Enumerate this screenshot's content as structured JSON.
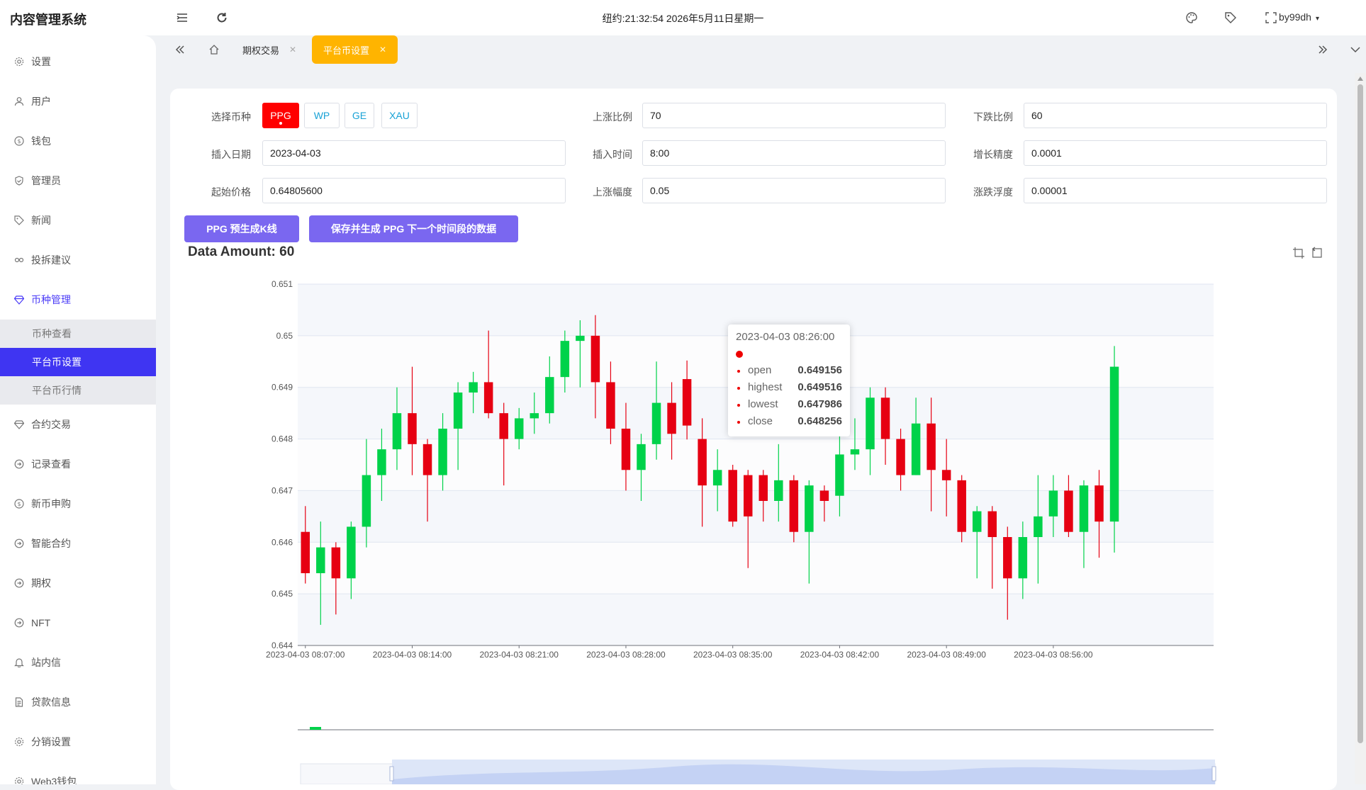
{
  "app": {
    "title": "内容管理系统",
    "clock": "纽约:21:32:54 2026年5月11日星期一",
    "user": "by99dh"
  },
  "sidebar": {
    "items": [
      {
        "label": "设置",
        "icon": "gear-icon"
      },
      {
        "label": "用户",
        "icon": "user-icon"
      },
      {
        "label": "钱包",
        "icon": "dollar-icon"
      },
      {
        "label": "管理员",
        "icon": "shield-icon"
      },
      {
        "label": "新闻",
        "icon": "tag-icon"
      },
      {
        "label": "投拆建议",
        "icon": "link-icon"
      },
      {
        "label": "币种管理",
        "icon": "diamond-icon"
      }
    ],
    "submenu": [
      {
        "label": "币种查看"
      },
      {
        "label": "平台币设置"
      },
      {
        "label": "平台币行情"
      }
    ],
    "items_after": [
      {
        "label": "合约交易",
        "icon": "diamond-icon"
      },
      {
        "label": "记录查看",
        "icon": "circle-arrow-icon"
      },
      {
        "label": "新币申购",
        "icon": "dollar-icon"
      },
      {
        "label": "智能合约",
        "icon": "circle-arrow-icon"
      },
      {
        "label": "期权",
        "icon": "circle-arrow-icon"
      },
      {
        "label": "NFT",
        "icon": "circle-arrow-icon"
      },
      {
        "label": "站内信",
        "icon": "bell-icon"
      },
      {
        "label": "贷款信息",
        "icon": "document-icon"
      },
      {
        "label": "分销设置",
        "icon": "gear-icon"
      },
      {
        "label": "Web3钱包",
        "icon": "gear-icon"
      }
    ]
  },
  "tabs": [
    {
      "label": "期权交易"
    },
    {
      "label": "平台币设置"
    }
  ],
  "form": {
    "coin_label": "选择币种",
    "coins": [
      "PPG",
      "WP",
      "GE",
      "XAU"
    ],
    "selected_coin": "PPG",
    "up_ratio_label": "上涨比例",
    "up_ratio": "70",
    "down_ratio_label": "下跌比例",
    "down_ratio": "60",
    "insert_date_label": "插入日期",
    "insert_date": "2023-04-03",
    "insert_time_label": "插入时间",
    "insert_time": "8:00",
    "precision_label": "增长精度",
    "precision": "0.0001",
    "start_price_label": "起始价格",
    "start_price": "0.64805600",
    "up_range_label": "上涨幅度",
    "up_range": "0.05",
    "float_label": "涨跌浮度",
    "float": "0.00001"
  },
  "buttons": {
    "generate": "PPG 预生成K线",
    "save": "保存并生成 PPG 下一个时间段的数据"
  },
  "data_amount": "Data Amount: 60",
  "tooltip": {
    "title": "2023-04-03 08:26:00",
    "rows": [
      {
        "key": "open",
        "value": "0.649156"
      },
      {
        "key": "highest",
        "value": "0.649516"
      },
      {
        "key": "lowest",
        "value": "0.647986"
      },
      {
        "key": "close",
        "value": "0.648256"
      }
    ]
  },
  "colors": {
    "up": "#00d24a",
    "down": "#e60012",
    "accent": "#3f35f2",
    "tab_active": "#ffb400",
    "button": "#7a67f0"
  },
  "chart_data": {
    "type": "candlestick",
    "ylim": [
      0.644,
      0.651
    ],
    "yticks": [
      0.644,
      0.645,
      0.646,
      0.647,
      0.648,
      0.649,
      0.65,
      0.651
    ],
    "ytick_labels": [
      "0.644",
      "0.645",
      "0.646",
      "0.647",
      "0.648",
      "0.649",
      "0.65",
      "0.651"
    ],
    "xtick_labels": [
      "2023-04-03 08:07:00",
      "2023-04-03 08:14:00",
      "2023-04-03 08:21:00",
      "2023-04-03 08:28:00",
      "2023-04-03 08:35:00",
      "2023-04-03 08:42:00",
      "2023-04-03 08:49:00",
      "2023-04-03 08:56:00"
    ],
    "x_start": "2023-04-03 08:07:00",
    "interval_minutes": 1,
    "candles": [
      {
        "o": 0.6462,
        "c": 0.6454,
        "h": 0.6467,
        "l": 0.6452
      },
      {
        "o": 0.6454,
        "c": 0.6459,
        "h": 0.6464,
        "l": 0.6444
      },
      {
        "o": 0.6459,
        "c": 0.6453,
        "h": 0.646,
        "l": 0.6446
      },
      {
        "o": 0.6453,
        "c": 0.6463,
        "h": 0.6464,
        "l": 0.6449
      },
      {
        "o": 0.6463,
        "c": 0.6473,
        "h": 0.648,
        "l": 0.6459
      },
      {
        "o": 0.6473,
        "c": 0.6478,
        "h": 0.6482,
        "l": 0.6468
      },
      {
        "o": 0.6478,
        "c": 0.6485,
        "h": 0.649,
        "l": 0.6474
      },
      {
        "o": 0.6485,
        "c": 0.6479,
        "h": 0.6494,
        "l": 0.6473
      },
      {
        "o": 0.6479,
        "c": 0.6473,
        "h": 0.648,
        "l": 0.6464
      },
      {
        "o": 0.6473,
        "c": 0.6482,
        "h": 0.6485,
        "l": 0.647
      },
      {
        "o": 0.6482,
        "c": 0.6489,
        "h": 0.6491,
        "l": 0.6474
      },
      {
        "o": 0.6489,
        "c": 0.6491,
        "h": 0.6493,
        "l": 0.6485
      },
      {
        "o": 0.6491,
        "c": 0.6485,
        "h": 0.6501,
        "l": 0.6484
      },
      {
        "o": 0.6485,
        "c": 0.648,
        "h": 0.6487,
        "l": 0.6471
      },
      {
        "o": 0.648,
        "c": 0.6484,
        "h": 0.6486,
        "l": 0.6478
      },
      {
        "o": 0.6484,
        "c": 0.6485,
        "h": 0.6489,
        "l": 0.6481
      },
      {
        "o": 0.6485,
        "c": 0.6492,
        "h": 0.6496,
        "l": 0.6483
      },
      {
        "o": 0.6492,
        "c": 0.6499,
        "h": 0.6501,
        "l": 0.6489
      },
      {
        "o": 0.6499,
        "c": 0.65,
        "h": 0.6503,
        "l": 0.649
      },
      {
        "o": 0.65,
        "c": 0.6491,
        "h": 0.6504,
        "l": 0.6484
      },
      {
        "o": 0.6491,
        "c": 0.6482,
        "h": 0.6495,
        "l": 0.6479
      },
      {
        "o": 0.6482,
        "c": 0.6474,
        "h": 0.6487,
        "l": 0.647
      },
      {
        "o": 0.6474,
        "c": 0.6479,
        "h": 0.6481,
        "l": 0.6468
      },
      {
        "o": 0.6479,
        "c": 0.6487,
        "h": 0.6495,
        "l": 0.6476
      },
      {
        "o": 0.6487,
        "c": 0.6481,
        "h": 0.6491,
        "l": 0.6476
      },
      {
        "o": 0.64916,
        "c": 0.64826,
        "h": 0.64952,
        "l": 0.64799
      },
      {
        "o": 0.648,
        "c": 0.6471,
        "h": 0.6484,
        "l": 0.6463
      },
      {
        "o": 0.6471,
        "c": 0.6474,
        "h": 0.6478,
        "l": 0.6466
      },
      {
        "o": 0.6474,
        "c": 0.6464,
        "h": 0.6475,
        "l": 0.6463
      },
      {
        "o": 0.6473,
        "c": 0.6465,
        "h": 0.6474,
        "l": 0.6455
      },
      {
        "o": 0.6473,
        "c": 0.6468,
        "h": 0.6474,
        "l": 0.6464
      },
      {
        "o": 0.6468,
        "c": 0.6472,
        "h": 0.6479,
        "l": 0.6464
      },
      {
        "o": 0.6472,
        "c": 0.6462,
        "h": 0.6473,
        "l": 0.646
      },
      {
        "o": 0.6462,
        "c": 0.6471,
        "h": 0.6472,
        "l": 0.6452
      },
      {
        "o": 0.647,
        "c": 0.6468,
        "h": 0.6471,
        "l": 0.6464
      },
      {
        "o": 0.6469,
        "c": 0.6477,
        "h": 0.6485,
        "l": 0.6465
      },
      {
        "o": 0.6477,
        "c": 0.6478,
        "h": 0.6484,
        "l": 0.6474
      },
      {
        "o": 0.6478,
        "c": 0.6488,
        "h": 0.649,
        "l": 0.6473
      },
      {
        "o": 0.6488,
        "c": 0.648,
        "h": 0.649,
        "l": 0.6475
      },
      {
        "o": 0.648,
        "c": 0.6473,
        "h": 0.6482,
        "l": 0.647
      },
      {
        "o": 0.6473,
        "c": 0.6483,
        "h": 0.6488,
        "l": 0.6473
      },
      {
        "o": 0.6483,
        "c": 0.6474,
        "h": 0.6488,
        "l": 0.6466
      },
      {
        "o": 0.6474,
        "c": 0.6472,
        "h": 0.648,
        "l": 0.6465
      },
      {
        "o": 0.6472,
        "c": 0.6462,
        "h": 0.6473,
        "l": 0.646
      },
      {
        "o": 0.6462,
        "c": 0.6466,
        "h": 0.6467,
        "l": 0.6453
      },
      {
        "o": 0.6466,
        "c": 0.6461,
        "h": 0.6467,
        "l": 0.6451
      },
      {
        "o": 0.6461,
        "c": 0.6453,
        "h": 0.6463,
        "l": 0.6445
      },
      {
        "o": 0.6453,
        "c": 0.6461,
        "h": 0.6464,
        "l": 0.6449
      },
      {
        "o": 0.6461,
        "c": 0.6465,
        "h": 0.6473,
        "l": 0.6452
      },
      {
        "o": 0.6465,
        "c": 0.647,
        "h": 0.6473,
        "l": 0.6461
      },
      {
        "o": 0.647,
        "c": 0.6462,
        "h": 0.6473,
        "l": 0.6461
      },
      {
        "o": 0.6462,
        "c": 0.6471,
        "h": 0.6472,
        "l": 0.6455
      },
      {
        "o": 0.6471,
        "c": 0.6464,
        "h": 0.6474,
        "l": 0.6457
      },
      {
        "o": 0.6464,
        "c": 0.6494,
        "h": 0.6498,
        "l": 0.6458
      }
    ]
  }
}
